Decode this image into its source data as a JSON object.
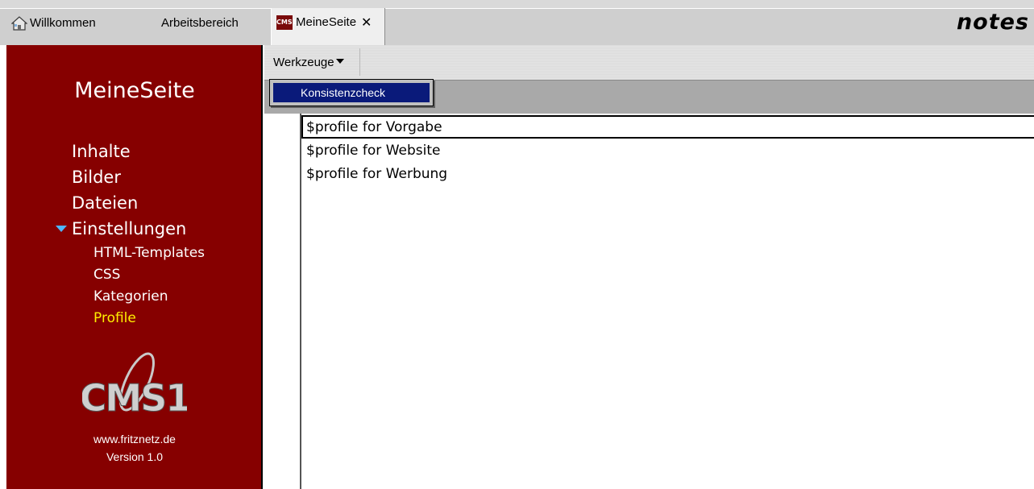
{
  "tabs": {
    "home_label": "Willkommen",
    "work_label": "Arbeitsbereich",
    "active_label": "MeineSeite",
    "active_icon_text": "CMS1",
    "close_symbol": "✕"
  },
  "brand": "notes",
  "sidebar": {
    "title": "MeineSeite",
    "nav": {
      "inhalte": "Inhalte",
      "bilder": "Bilder",
      "dateien": "Dateien",
      "einstellungen": "Einstellungen"
    },
    "subnav": {
      "html_templates": "HTML-Templates",
      "css": "CSS",
      "kategorien": "Kategorien",
      "profile": "Profile"
    },
    "logo_text": "CMS1",
    "url": "www.fritznetz.de",
    "version": "Version 1.0"
  },
  "toolbar": {
    "menu_label": "Werkzeuge"
  },
  "dropdown": {
    "item": "Konsistenzcheck"
  },
  "rows": [
    "$profile for Vorgabe",
    "$profile for Website",
    "$profile for Werbung"
  ],
  "colors": {
    "sidebar_bg": "#860000",
    "active_nav": "#ffee00",
    "expand_arrow": "#4fb6ff",
    "menu_highlight": "#0a1a7a"
  },
  "icons": {
    "home": "home-icon",
    "cms": "cms1-tab-icon",
    "close": "close-icon",
    "expand": "triangle-down-icon",
    "caret": "caret-down-icon"
  }
}
